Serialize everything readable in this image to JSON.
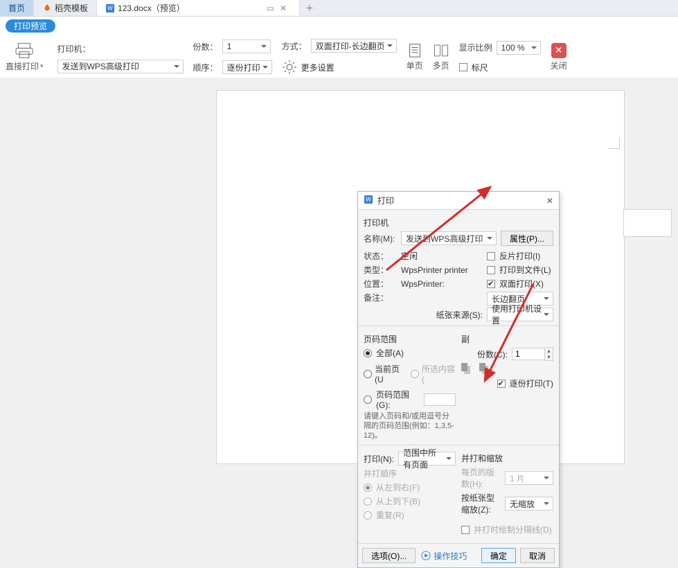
{
  "tabs": {
    "home": "首页",
    "template": "稻壳模板",
    "doc": "123.docx（预览）"
  },
  "preview_badge": "打印预览",
  "toolbar": {
    "direct_print": "直接打印",
    "printer_label": "打印机：",
    "printer_value": "发送到WPS高级打印",
    "copies_label": "份数：",
    "copies_value": "1",
    "order_label": "顺序：",
    "order_value": "逐份打印",
    "mode_label": "方式：",
    "mode_value": "双面打印-长边翻页",
    "more_settings": "更多设置",
    "single_page": "单页",
    "multi_page": "多页",
    "zoom_label": "显示比例",
    "zoom_value": "100 %",
    "ruler": "标尺",
    "close": "关闭"
  },
  "dlg": {
    "title": "打印",
    "printer": "打印机",
    "name_label": "名称(M):",
    "name_value": "发送到WPS高级打印",
    "props_btn": "属性(P)...",
    "status_label": "状态：",
    "status_value": "空闲",
    "type_label": "类型：",
    "type_value": "WpsPrinter printer",
    "where_label": "位置：",
    "where_value": "WpsPrinter:",
    "note_label": "备注：",
    "chk_reverse": "反片打印(I)",
    "chk_tofile": "打印到文件(L)",
    "chk_duplex": "双面打印(X)",
    "duplex_mode": "长边翻页",
    "paper_source_label": "纸张来源(S):",
    "paper_source_value": "使用打印机设置",
    "range_title": "页码范围",
    "range_all": "全部(A)",
    "range_current": "当前页(U",
    "range_selection": "所选内容(",
    "range_pages": "页码范围(G):",
    "range_hint": "请键入页码和/或用逗号分隔的页码范围(例如：1,3,5-12)。",
    "copies_title": "副",
    "copies_count_label": "份数(C):",
    "copies_count_value": "1",
    "collate": "逐份打印(T)",
    "printN_label": "打印(N):",
    "printN_value": "范围中所有页面",
    "merge_title": "并打和缩放",
    "sheets_label": "每页的版数(H):",
    "sheets_value": "1 片",
    "scale_label": "按纸张型缩放(Z):",
    "scale_value": "无缩放",
    "merge_order_title": "并打顺序",
    "merge_lr": "从左到右(F)",
    "merge_tb": "从上到下(B)",
    "merge_repeat": "重复(R)",
    "merge_line": "并打时绘制分隔线(D)",
    "options_btn": "选项(O)...",
    "tips": "操作技巧",
    "ok": "确定",
    "cancel": "取消"
  }
}
